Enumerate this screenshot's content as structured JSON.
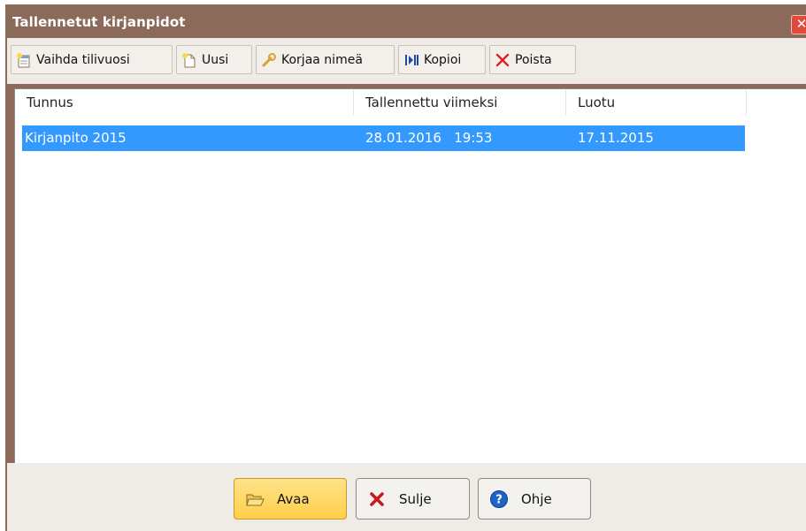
{
  "window": {
    "title": "Tallennetut kirjanpidot",
    "close_icon": "close-icon"
  },
  "toolbar": {
    "items": [
      {
        "label": "Vaihda tilivuosi",
        "icon": "calendar-new-icon"
      },
      {
        "label": "Uusi",
        "icon": "new-document-icon"
      },
      {
        "label": "Korjaa nimeä",
        "icon": "wrench-icon"
      },
      {
        "label": "Kopioi",
        "icon": "copy-icon"
      },
      {
        "label": "Poista",
        "icon": "delete-icon"
      }
    ]
  },
  "table": {
    "columns": [
      "Tunnus",
      "Tallennettu viimeksi",
      "Luotu"
    ],
    "rows": [
      {
        "tunnus": "Kirjanpito 2015",
        "tallennettu": "28.01.2016   19:53",
        "luotu": "17.11.2015",
        "selected": true
      }
    ]
  },
  "buttons": {
    "open": {
      "label": "Avaa",
      "icon": "open-folder-icon"
    },
    "close": {
      "label": "Sulje",
      "icon": "close-x-icon"
    },
    "help": {
      "label": "Ohje",
      "icon": "help-icon"
    }
  },
  "colors": {
    "title_bar": "#8c6a5a",
    "selection": "#3399ff",
    "primary_button": "#ffd65c"
  }
}
